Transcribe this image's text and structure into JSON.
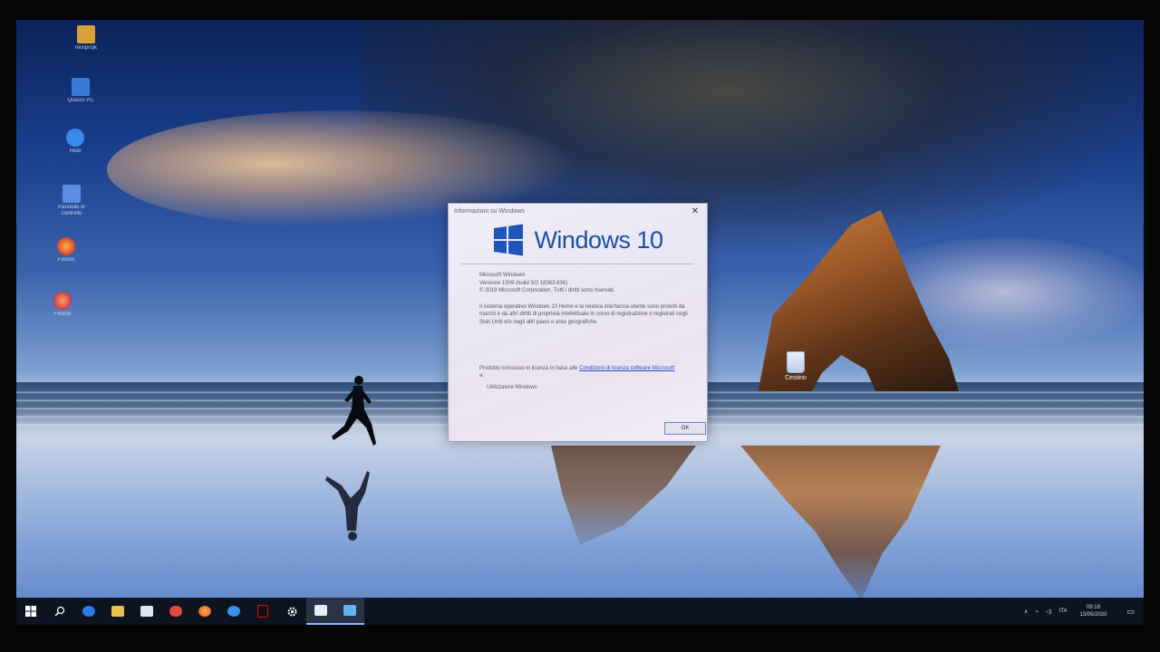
{
  "desktop": {
    "icons": [
      {
        "label": "nexlprojk",
        "color": "#d8a13a"
      },
      {
        "label": "Questo PC",
        "color": "#3a7ad8"
      },
      {
        "label": "Rete",
        "color": "#3a8ae8"
      },
      {
        "label": "Pannello di controllo",
        "color": "#5b8ee0"
      },
      {
        "label": "Firefox",
        "color": "#e0562a"
      },
      {
        "label": "Firefox",
        "color": "#d94a4a"
      }
    ],
    "recycle_bin_label": "Cestino"
  },
  "dialog": {
    "title": "Informazioni su Windows",
    "close_glyph": "✕",
    "logo_text": "Windows 10",
    "product": "Microsoft Windows",
    "version": "Versione 1909 (build SO 18363.836)",
    "copyright": "© 2019 Microsoft Corporation. Tutti i diritti sono riservati.",
    "description": "Il sistema operativo Windows 10 Home e la relativa interfaccia utente sono protetti da marchi e da altri diritti di proprietà intellettuale in corso di registrazione o registrati negli Stati Uniti e/o negli altri paesi o aree geografiche.",
    "license_prefix": "Prodotto concesso in licenza in base alle ",
    "license_link": "Condizioni di licenza software Microsoft",
    "license_suffix": " a:",
    "licensee": "Utilizzatore Windows",
    "ok_label": "OK"
  },
  "taskbar": {
    "items": [
      {
        "name": "start-icon",
        "color": "#ffffff"
      },
      {
        "name": "search-icon",
        "color": "#ffffff"
      },
      {
        "name": "edge-icon",
        "color": "#2f7be8"
      },
      {
        "name": "file-explorer-icon",
        "color": "#e8c24a"
      },
      {
        "name": "store-icon",
        "color": "#dfe6f2"
      },
      {
        "name": "paint-icon",
        "color": "#e24b3b"
      },
      {
        "name": "firefox-icon",
        "color": "#f07a2a"
      },
      {
        "name": "teamviewer-icon",
        "color": "#3a8fe8"
      },
      {
        "name": "netflix-icon",
        "color": "#e50914"
      },
      {
        "name": "settings-icon",
        "color": "#ffffff"
      },
      {
        "name": "winver-icon",
        "color": "#e8edf7"
      },
      {
        "name": "window-icon",
        "color": "#63b4f0"
      }
    ],
    "tray": {
      "language": "ITA",
      "time": "09:18",
      "date": "13/05/2020"
    }
  }
}
